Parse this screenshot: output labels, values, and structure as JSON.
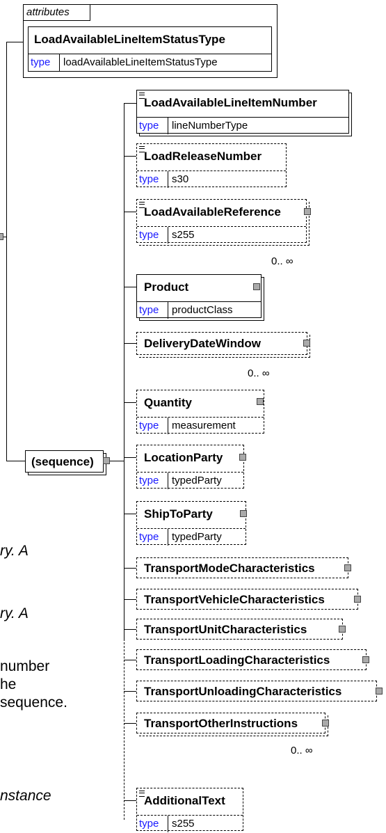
{
  "attributes": {
    "label": "attributes",
    "items": [
      {
        "name": "LoadAvailableLineItemStatusType",
        "type_keyword": "type",
        "type_value": "loadAvailableLineItemStatusType"
      }
    ]
  },
  "sequence": {
    "label": "(sequence)"
  },
  "elements": [
    {
      "name": "LoadAvailableLineItemNumber",
      "type_keyword": "type",
      "type_value": "lineNumberType"
    },
    {
      "name": "LoadReleaseNumber",
      "type_keyword": "type",
      "type_value": "s30"
    },
    {
      "name": "LoadAvailableReference",
      "type_keyword": "type",
      "type_value": "s255",
      "occurrence": "0.. ∞"
    },
    {
      "name": "Product",
      "type_keyword": "type",
      "type_value": "productClass"
    },
    {
      "name": "DeliveryDateWindow",
      "occurrence": "0.. ∞"
    },
    {
      "name": "Quantity",
      "type_keyword": "type",
      "type_value": "measurement"
    },
    {
      "name": "LocationParty",
      "type_keyword": "type",
      "type_value": "typedParty"
    },
    {
      "name": "ShipToParty",
      "type_keyword": "type",
      "type_value": "typedParty"
    },
    {
      "name": "TransportModeCharacteristics"
    },
    {
      "name": "TransportVehicleCharacteristics"
    },
    {
      "name": "TransportUnitCharacteristics"
    },
    {
      "name": "TransportLoadingCharacteristics"
    },
    {
      "name": "TransportUnloadingCharacteristics"
    },
    {
      "name": "TransportOtherInstructions",
      "occurrence": "0.. ∞"
    },
    {
      "name": "AdditionalText",
      "type_keyword": "type",
      "type_value": "s255"
    }
  ],
  "left_text": {
    "t1": "ry. A",
    "t2": "ry. A",
    "t3": "number",
    "t4": "he",
    "t5": "sequence.",
    "t6": "nstance"
  }
}
